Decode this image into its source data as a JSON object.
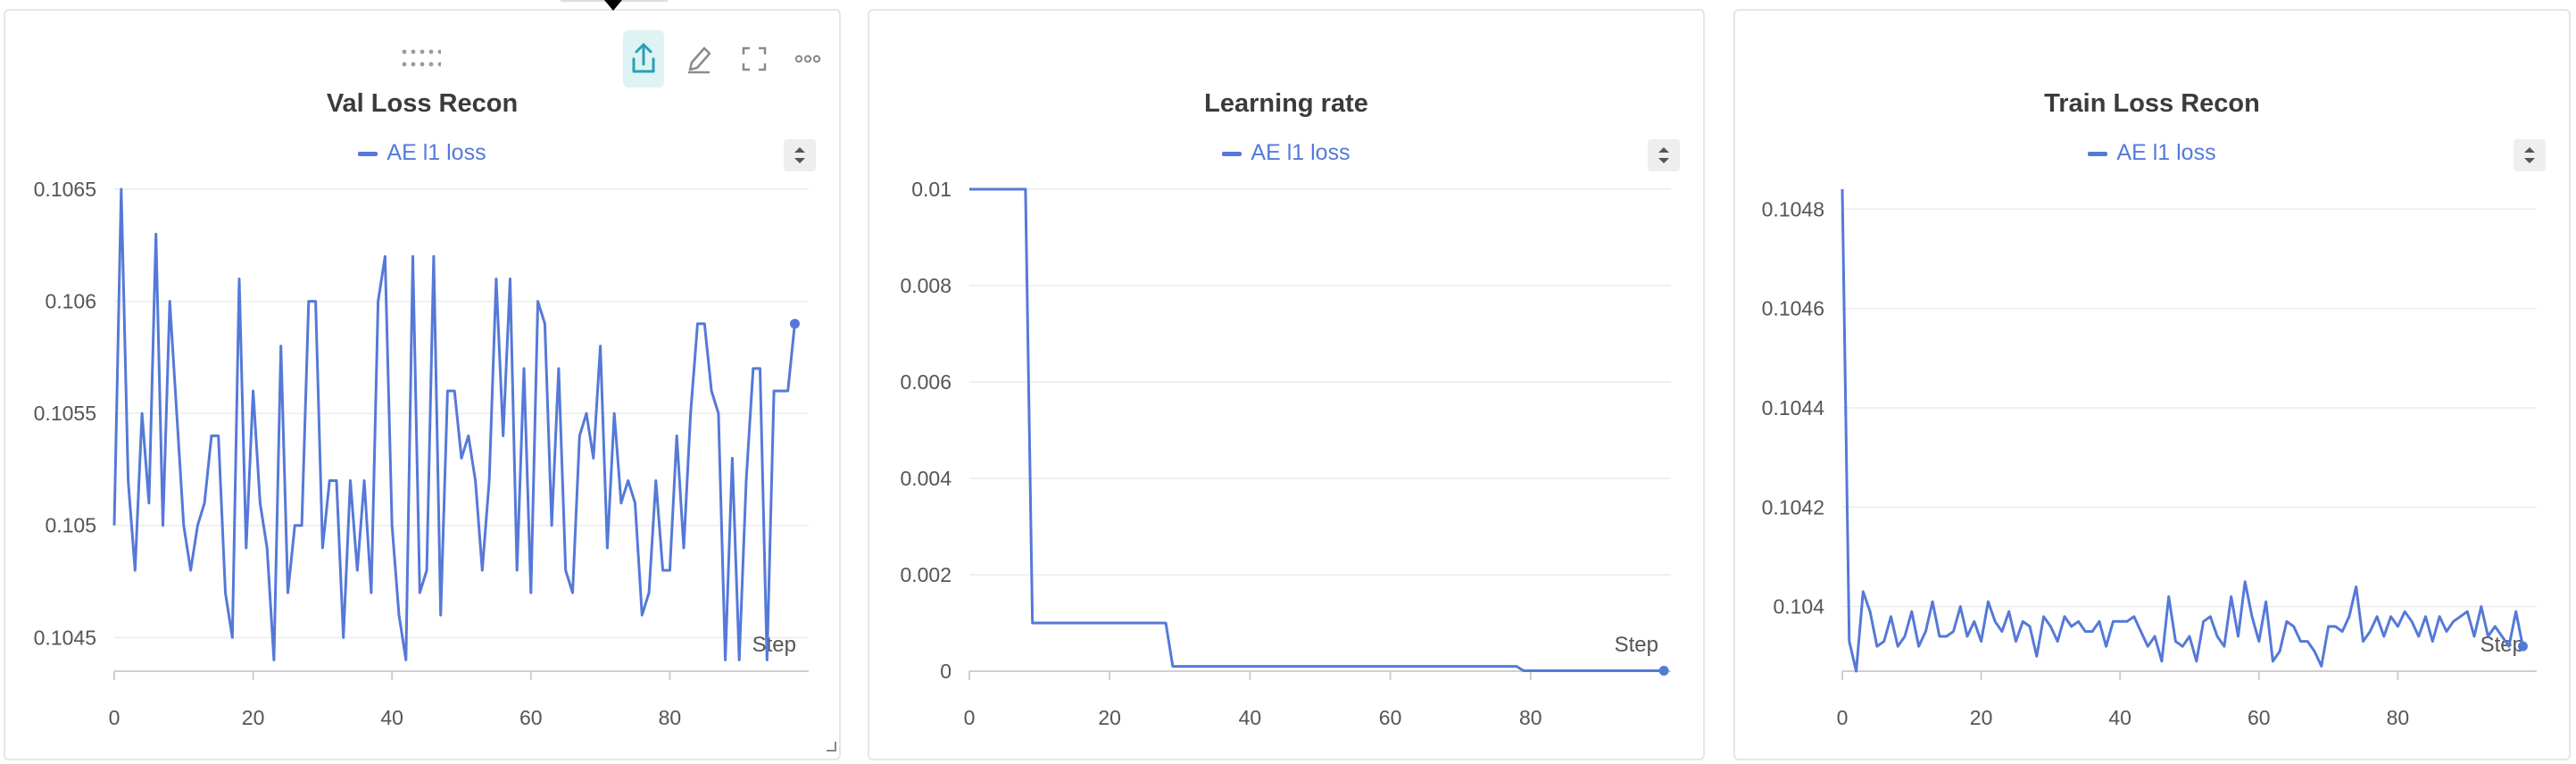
{
  "panels": [
    {
      "title": "Val Loss Recon",
      "legend": "AE l1 loss",
      "color": "#5579d8",
      "x_axis_label": "Step"
    },
    {
      "title": "Learning rate",
      "legend": "AE l1 loss",
      "color": "#5579d8",
      "x_axis_label": "Step"
    },
    {
      "title": "Train Loss Recon",
      "legend": "AE l1 loss",
      "color": "#5579d8",
      "x_axis_label": "Step"
    }
  ],
  "toolbar": {
    "icons": [
      "drag-handle-icon",
      "share-icon",
      "edit-icon",
      "fullscreen-icon",
      "more-icon"
    ]
  },
  "chart_data": [
    {
      "type": "line",
      "title": "Val Loss Recon",
      "xlabel": "Step",
      "ylabel": "",
      "xlim": [
        0,
        100
      ],
      "ylim": [
        0.10435,
        0.1065
      ],
      "x_ticks": [
        0,
        20,
        40,
        60,
        80
      ],
      "y_ticks": [
        0.1045,
        0.105,
        0.1055,
        0.106,
        0.1065
      ],
      "y_tick_labels": [
        "0.1045",
        "0.105",
        "0.1055",
        "0.106",
        "0.1065"
      ],
      "grid": true,
      "legend_position": "top-center",
      "series": [
        {
          "name": "AE l1 loss",
          "values": [
            0.105,
            0.1065,
            0.1052,
            0.1048,
            0.1055,
            0.1051,
            0.1063,
            0.105,
            0.106,
            0.1055,
            0.105,
            0.1048,
            0.105,
            0.1051,
            0.1054,
            0.1054,
            0.1047,
            0.1045,
            0.1061,
            0.1049,
            0.1056,
            0.1051,
            0.1049,
            0.1044,
            0.1058,
            0.1047,
            0.105,
            0.105,
            0.106,
            0.106,
            0.1049,
            0.1052,
            0.1052,
            0.1045,
            0.1052,
            0.1048,
            0.1052,
            0.1047,
            0.106,
            0.1062,
            0.105,
            0.1046,
            0.1044,
            0.1062,
            0.1047,
            0.1048,
            0.1062,
            0.1046,
            0.1056,
            0.1056,
            0.1053,
            0.1054,
            0.1052,
            0.1048,
            0.1052,
            0.1061,
            0.1054,
            0.1061,
            0.1048,
            0.1057,
            0.1047,
            0.106,
            0.1059,
            0.105,
            0.1057,
            0.1048,
            0.1047,
            0.1054,
            0.1055,
            0.1053,
            0.1058,
            0.1049,
            0.1055,
            0.1051,
            0.1052,
            0.1051,
            0.1046,
            0.1047,
            0.1052,
            0.1048,
            0.1048,
            0.1054,
            0.1049,
            0.1055,
            0.1059,
            0.1059,
            0.1056,
            0.1055,
            0.1044,
            0.1053,
            0.1044,
            0.1052,
            0.1057,
            0.1057,
            0.1044,
            0.1056,
            0.1056,
            0.1056,
            0.1059
          ]
        }
      ]
    },
    {
      "type": "line",
      "title": "Learning rate",
      "xlabel": "Step",
      "ylabel": "",
      "xlim": [
        0,
        100
      ],
      "ylim": [
        0,
        0.01
      ],
      "x_ticks": [
        0,
        20,
        40,
        60,
        80
      ],
      "y_ticks": [
        0,
        0.002,
        0.004,
        0.006,
        0.008,
        0.01
      ],
      "y_tick_labels": [
        "0",
        "0.002",
        "0.004",
        "0.006",
        "0.008",
        "0.01"
      ],
      "grid": true,
      "legend_position": "top-center",
      "series": [
        {
          "name": "AE l1 loss",
          "x": [
            0,
            8,
            9,
            28,
            29,
            78,
            79,
            99
          ],
          "values": [
            0.01,
            0.01,
            0.001,
            0.001,
            0.0001,
            0.0001,
            1e-05,
            1e-05
          ]
        }
      ]
    },
    {
      "type": "line",
      "title": "Train Loss Recon",
      "xlabel": "Step",
      "ylabel": "",
      "xlim": [
        0,
        100
      ],
      "ylim": [
        0.10387,
        0.10484
      ],
      "x_ticks": [
        0,
        20,
        40,
        60,
        80
      ],
      "y_ticks": [
        0.104,
        0.1042,
        0.1044,
        0.1046,
        0.1048
      ],
      "y_tick_labels": [
        "0.104",
        "0.1042",
        "0.1044",
        "0.1046",
        "0.1048"
      ],
      "grid": true,
      "legend_position": "top-center",
      "series": [
        {
          "name": "AE l1 loss",
          "values": [
            0.10484,
            0.10393,
            0.10387,
            0.10403,
            0.10399,
            0.10392,
            0.10393,
            0.10398,
            0.10392,
            0.10394,
            0.10399,
            0.10392,
            0.10395,
            0.10401,
            0.10394,
            0.10394,
            0.10395,
            0.104,
            0.10394,
            0.10397,
            0.10393,
            0.10401,
            0.10397,
            0.10395,
            0.10399,
            0.10393,
            0.10397,
            0.10396,
            0.1039,
            0.10398,
            0.10396,
            0.10393,
            0.10398,
            0.10396,
            0.10397,
            0.10395,
            0.10395,
            0.10397,
            0.10392,
            0.10397,
            0.10397,
            0.10397,
            0.10398,
            0.10395,
            0.10392,
            0.10394,
            0.10389,
            0.10402,
            0.10393,
            0.10392,
            0.10394,
            0.10389,
            0.10397,
            0.10398,
            0.10394,
            0.10392,
            0.10402,
            0.10394,
            0.10405,
            0.10398,
            0.10393,
            0.10401,
            0.10389,
            0.10391,
            0.10397,
            0.10396,
            0.10393,
            0.10393,
            0.10391,
            0.10388,
            0.10396,
            0.10396,
            0.10395,
            0.10398,
            0.10404,
            0.10393,
            0.10395,
            0.10398,
            0.10394,
            0.10398,
            0.10396,
            0.10399,
            0.10397,
            0.10394,
            0.10398,
            0.10393,
            0.10398,
            0.10395,
            0.10397,
            0.10398,
            0.10399,
            0.10394,
            0.104,
            0.10394,
            0.10396,
            0.10394,
            0.10392,
            0.10399,
            0.10392
          ]
        }
      ]
    }
  ]
}
